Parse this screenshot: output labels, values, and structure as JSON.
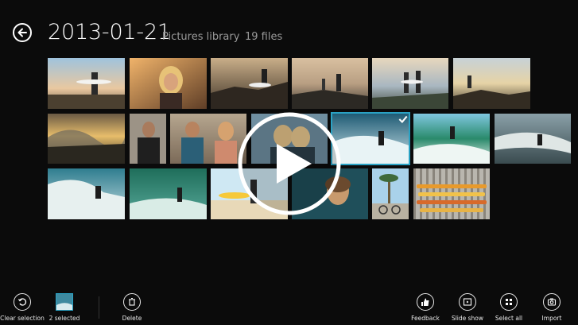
{
  "header": {
    "title": "2013-01-21",
    "subtitle": "Pictures library",
    "count": "19 files"
  },
  "photos": [
    {
      "label": "surfer-holding-board-on-rocks"
    },
    {
      "label": "woman-smiling-beach-sunset"
    },
    {
      "label": "surfer-crouching-on-rocks"
    },
    {
      "label": "surfers-walking-rocky-shore"
    },
    {
      "label": "surfers-walking-sunset-rocks"
    },
    {
      "label": "surfer-on-rock-sunset"
    },
    {
      "label": "wave-splash-sunset"
    },
    {
      "label": "surfer-in-wetsuit-portrait"
    },
    {
      "label": "two-surfers-smiling"
    },
    {
      "label": "video-two-women-selfie"
    },
    {
      "label": "surfer-riding-wave-selected"
    },
    {
      "label": "surfer-aerial-green-wave"
    },
    {
      "label": "surfer-cutback-wave"
    },
    {
      "label": "surfer-wave-spray"
    },
    {
      "label": "surfer-green-barrel"
    },
    {
      "label": "surfer-carrying-board-beach"
    },
    {
      "label": "woman-portrait-teal-frame"
    },
    {
      "label": "palm-trees-bikers"
    },
    {
      "label": "surfboards-on-rack"
    }
  ],
  "appbar": {
    "clear_selection": "Clear selection",
    "selected": "2 selected",
    "delete": "Delete",
    "feedback": "Feedback",
    "slide_show": "Slide show",
    "select_all": "Select all",
    "import": "Import"
  },
  "icons": {
    "back": "back-arrow-icon",
    "play": "play-icon",
    "check": "checkmark-icon"
  },
  "colors": {
    "background": "#0b0b0b",
    "accent": "#2aa2c4",
    "text_secondary": "#9a9a9a"
  }
}
